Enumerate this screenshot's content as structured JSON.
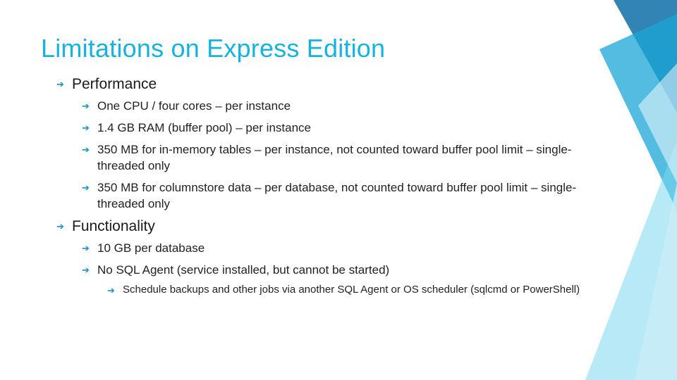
{
  "title": "Limitations on Express Edition",
  "sections": [
    {
      "heading": "Performance",
      "items": [
        {
          "text": "One CPU / four cores – per instance"
        },
        {
          "text": "1.4 GB RAM (buffer pool) – per instance"
        },
        {
          "text": "350 MB for in-memory tables – per instance, not counted toward buffer pool limit – single-threaded only"
        },
        {
          "text": "350 MB for columnstore data – per database, not counted toward buffer pool limit – single-threaded only"
        }
      ]
    },
    {
      "heading": "Functionality",
      "items": [
        {
          "text": "10 GB per database"
        },
        {
          "text": "No SQL Agent (service installed, but cannot be started)",
          "subitems": [
            {
              "text": "Schedule backups and other jobs via another SQL Agent or OS scheduler (sqlcmd or PowerShell)"
            }
          ]
        }
      ]
    }
  ],
  "bullet_glyph": "➔",
  "accent_color": "#16b2e0"
}
